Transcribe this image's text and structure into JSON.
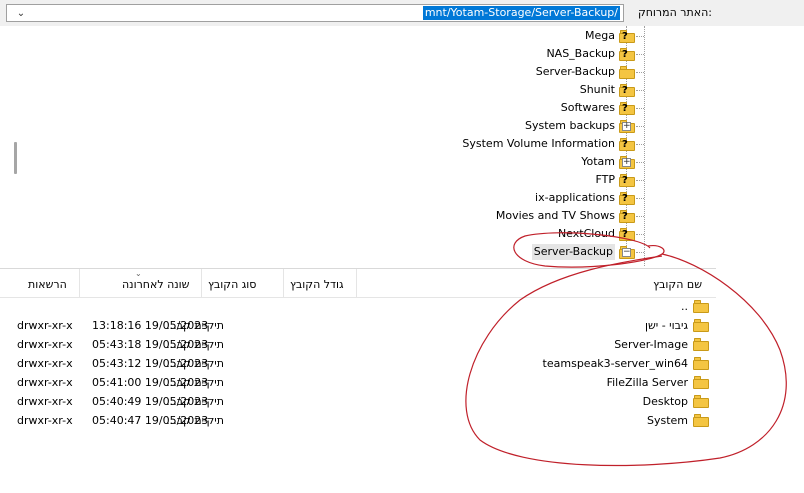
{
  "path_bar": {
    "label": "האתר המרוחק:",
    "path": "mnt/Yotam-Storage/Server-Backup/",
    "dropdown_icon": "chevron-down-icon"
  },
  "tree": {
    "items": [
      {
        "label": "Mega",
        "icon": "folder-question-icon",
        "expander": ""
      },
      {
        "label": "NAS_Backup",
        "icon": "folder-question-icon",
        "expander": ""
      },
      {
        "label": "Server-Backup",
        "icon": "folder-icon",
        "expander": ""
      },
      {
        "label": "Shunit",
        "icon": "folder-question-icon",
        "expander": ""
      },
      {
        "label": "Softwares",
        "icon": "folder-question-icon",
        "expander": ""
      },
      {
        "label": "System backups",
        "icon": "folder-icon",
        "expander": "+"
      },
      {
        "label": "System Volume Information",
        "icon": "folder-question-icon",
        "expander": ""
      },
      {
        "label": "Yotam",
        "icon": "folder-icon",
        "expander": "+"
      },
      {
        "label": "FTP",
        "icon": "folder-question-icon",
        "expander": ""
      },
      {
        "label": "ix-applications",
        "icon": "folder-question-icon",
        "expander": ""
      },
      {
        "label": "Movies and TV Shows",
        "icon": "folder-question-icon",
        "expander": ""
      },
      {
        "label": "NextCloud",
        "icon": "folder-question-icon",
        "expander": ""
      },
      {
        "label": "Server-Backup",
        "icon": "folder-icon",
        "expander": "−"
      }
    ]
  },
  "file_list": {
    "columns": {
      "name": "שם הקובץ",
      "size": "גודל הקובץ",
      "type": "סוג הקובץ",
      "modified": "שונה לאחרונה",
      "permissions": "הרשאות"
    },
    "rows": [
      {
        "name": "..",
        "type": "",
        "modified": "",
        "permissions": ""
      },
      {
        "name": "גיבוי - ישן",
        "type": "תיקיית קב...",
        "modified": "13:18:16 19/05/2023",
        "permissions": "drwxr-xr-x"
      },
      {
        "name": "Server-Image",
        "type": "תיקיית קב...",
        "modified": "05:43:18 19/05/2023",
        "permissions": "drwxr-xr-x"
      },
      {
        "name": "teamspeak3-server_win64",
        "type": "תיקיית קב...",
        "modified": "05:43:12 19/05/2023",
        "permissions": "drwxr-xr-x"
      },
      {
        "name": "FileZilla Server",
        "type": "תיקיית קב...",
        "modified": "05:41:00 19/05/2023",
        "permissions": "drwxr-xr-x"
      },
      {
        "name": "Desktop",
        "type": "תיקיית קב...",
        "modified": "05:40:49 19/05/2023",
        "permissions": "drwxr-xr-x"
      },
      {
        "name": "System",
        "type": "תיקיית קב...",
        "modified": "05:40:47 19/05/2023",
        "permissions": "drwxr-xr-x"
      }
    ]
  },
  "colors": {
    "selection": "#0078d7",
    "folder": "#f4c542",
    "annotation": "#c0202a"
  }
}
